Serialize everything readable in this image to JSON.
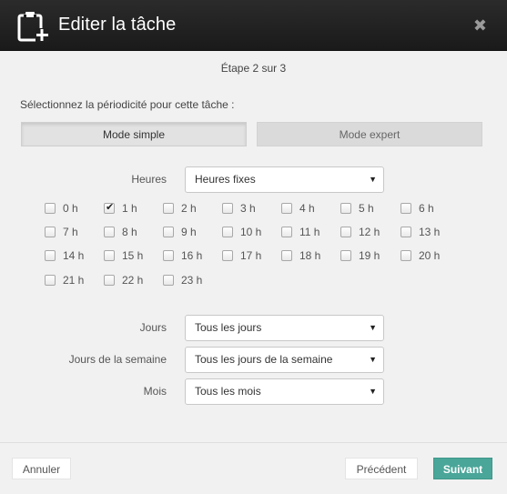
{
  "dialog": {
    "title": "Editer la tâche",
    "close_symbol": "✖"
  },
  "step": "Étape 2 sur 3",
  "prompt": "Sélectionnez la périodicité pour cette tâche :",
  "modes": {
    "simple": "Mode simple",
    "expert": "Mode expert",
    "active": "simple"
  },
  "fields": {
    "heures": {
      "label": "Heures",
      "value": "Heures fixes"
    },
    "jours": {
      "label": "Jours",
      "value": "Tous les jours"
    },
    "jours_semaine": {
      "label": "Jours de la semaine",
      "value": "Tous les jours de la semaine"
    },
    "mois": {
      "label": "Mois",
      "value": "Tous les mois"
    }
  },
  "hours": [
    {
      "label": "0 h",
      "checked": false
    },
    {
      "label": "1 h",
      "checked": true
    },
    {
      "label": "2 h",
      "checked": false
    },
    {
      "label": "3 h",
      "checked": false
    },
    {
      "label": "4 h",
      "checked": false
    },
    {
      "label": "5 h",
      "checked": false
    },
    {
      "label": "6 h",
      "checked": false
    },
    {
      "label": "7 h",
      "checked": false
    },
    {
      "label": "8 h",
      "checked": false
    },
    {
      "label": "9 h",
      "checked": false
    },
    {
      "label": "10 h",
      "checked": false
    },
    {
      "label": "11 h",
      "checked": false
    },
    {
      "label": "12 h",
      "checked": false
    },
    {
      "label": "13 h",
      "checked": false
    },
    {
      "label": "14 h",
      "checked": false
    },
    {
      "label": "15 h",
      "checked": false
    },
    {
      "label": "16 h",
      "checked": false
    },
    {
      "label": "17 h",
      "checked": false
    },
    {
      "label": "18 h",
      "checked": false
    },
    {
      "label": "19 h",
      "checked": false
    },
    {
      "label": "20 h",
      "checked": false
    },
    {
      "label": "21 h",
      "checked": false
    },
    {
      "label": "22 h",
      "checked": false
    },
    {
      "label": "23 h",
      "checked": false
    }
  ],
  "footer": {
    "cancel": "Annuler",
    "previous": "Précédent",
    "next": "Suivant"
  },
  "colors": {
    "titlebar": "#1f1f1f",
    "accent": "#4aa699"
  },
  "icons": {
    "title": "clipboard-add-icon",
    "close": "close-icon",
    "select_caret": "caret-down-icon",
    "checkbox_check": "check-icon"
  }
}
